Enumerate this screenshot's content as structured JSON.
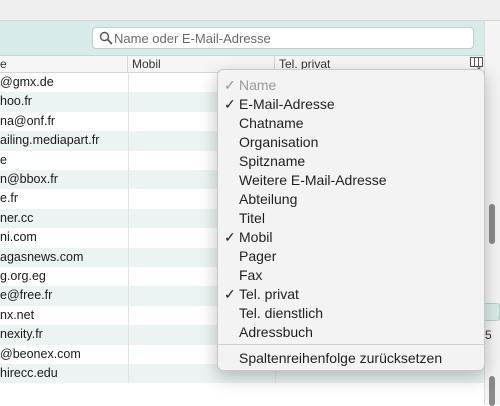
{
  "search": {
    "placeholder": "Name oder E-Mail-Adresse"
  },
  "columns": {
    "email": "e",
    "mobile": "Mobil",
    "phone": "Tel. privat"
  },
  "rows": [
    "@gmx.de",
    "hoo.fr",
    "na@onf.fr",
    "ailing.mediapart.fr",
    "e",
    "n@bbox.fr",
    "e.fr",
    "ner.cc",
    "ni.com",
    "agasnews.com",
    "g.org.eg",
    "e@free.fr",
    "nx.net",
    "nexity.fr",
    "@beonex.com",
    "hirecc.edu"
  ],
  "menu": {
    "items": [
      {
        "label": "Name",
        "checked": "✓",
        "disabled": true
      },
      {
        "label": "E-Mail-Adresse",
        "checked": "✓",
        "disabled": false
      },
      {
        "label": "Chatname",
        "checked": "",
        "disabled": false
      },
      {
        "label": "Organisation",
        "checked": "",
        "disabled": false
      },
      {
        "label": "Spitzname",
        "checked": "",
        "disabled": false
      },
      {
        "label": "Weitere E-Mail-Adresse",
        "checked": "",
        "disabled": false
      },
      {
        "label": "Abteilung",
        "checked": "",
        "disabled": false
      },
      {
        "label": "Titel",
        "checked": "",
        "disabled": false
      },
      {
        "label": "Mobil",
        "checked": "✓",
        "disabled": false
      },
      {
        "label": "Pager",
        "checked": "",
        "disabled": false
      },
      {
        "label": "Fax",
        "checked": "",
        "disabled": false
      },
      {
        "label": "Tel. privat",
        "checked": "✓",
        "disabled": false
      },
      {
        "label": "Tel. dienstlich",
        "checked": "",
        "disabled": false
      },
      {
        "label": "Adressbuch",
        "checked": "",
        "disabled": false
      }
    ],
    "reset_label": "Spaltenreihenfolge zurücksetzen"
  },
  "side": {
    "number": "5"
  },
  "colors": {
    "toolbar": "#d7ecea",
    "alt_row": "#ebf4f3",
    "menu_bg": "#f3f3f3"
  },
  "icons": {
    "search": "search-icon",
    "column_picker": "column-picker-icon"
  }
}
